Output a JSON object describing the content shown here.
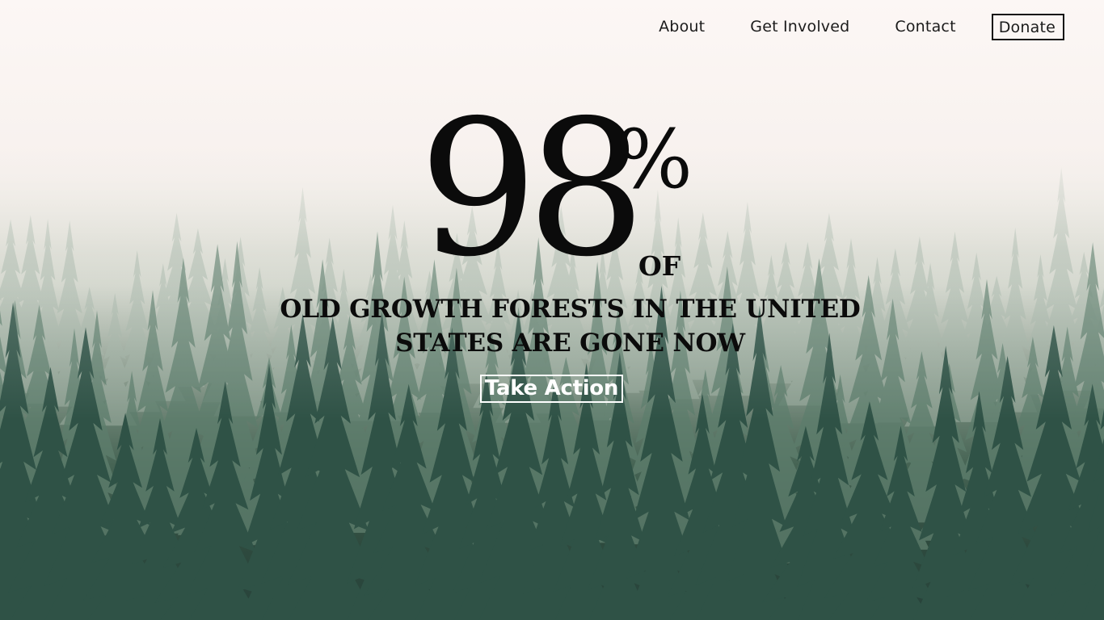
{
  "nav": {
    "items": [
      "About",
      "Get Involved",
      "Contact"
    ],
    "donate_label": "Donate"
  },
  "hero": {
    "stat_number": "98",
    "stat_symbol": "%",
    "stat_suffix": "OF",
    "headline": "OLD GROWTH FORESTS IN THE UNITED STATES ARE GONE NOW",
    "cta_label": "Take Action"
  },
  "colors": {
    "text": "#0b0b0b",
    "cta_border": "#ffffff",
    "forest_dark": "#27423a",
    "fog": "#fcf6f4"
  },
  "background": {
    "image_subject": "misty-pine-forest"
  }
}
